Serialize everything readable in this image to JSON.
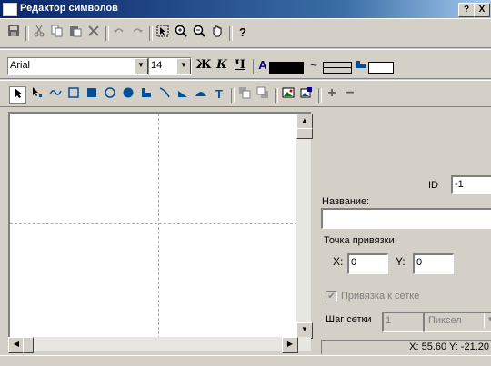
{
  "window": {
    "title": "Редактор символов",
    "help_button": "?",
    "close_button": "X"
  },
  "toolbar1": {
    "help_label": "?"
  },
  "toolbar2": {
    "font_name": "Arial",
    "font_size": "14",
    "bold_label": "Ж",
    "italic_label": "К",
    "underline_label": "Ч",
    "text_color_label": "A"
  },
  "toolbar3": {
    "text_tool_label": "T",
    "plus_label": "+",
    "minus_label": "−"
  },
  "panel": {
    "id_label": "ID",
    "id_value": "-1",
    "name_label": "Название:",
    "name_value": "",
    "anchor_label": "Точка привязки",
    "x_label": "X:",
    "x_value": "0",
    "y_label": "Y:",
    "y_value": "0",
    "snap_label": "Привязка к сетке",
    "grid_step_label": "Шаг сетки",
    "grid_step_value": "1",
    "grid_unit": "Пиксел"
  },
  "status": {
    "coords": "X: 55.60 Y: -21.20"
  },
  "colors": {
    "title_start": "#0a246a",
    "title_end": "#a6caf0",
    "face": "#d4d0c8"
  }
}
